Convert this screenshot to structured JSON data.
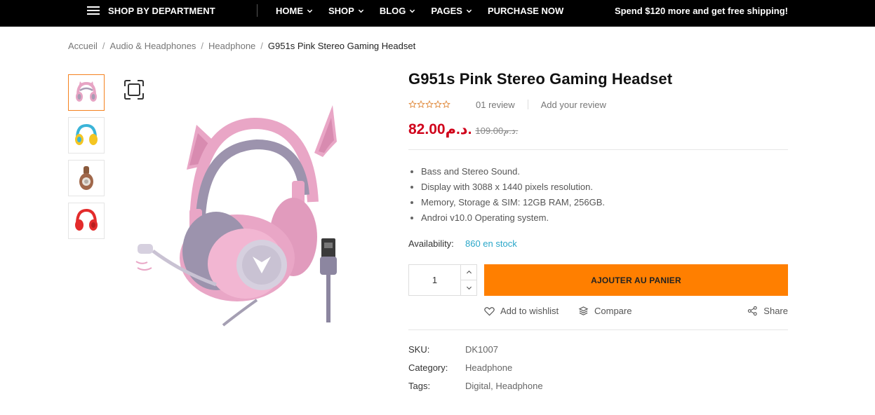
{
  "topbar": {
    "department_label": "SHOP BY DEPARTMENT",
    "menu": [
      {
        "label": "HOME"
      },
      {
        "label": "SHOP"
      },
      {
        "label": "BLOG"
      },
      {
        "label": "PAGES"
      },
      {
        "label": "PURCHASE NOW"
      }
    ],
    "promo": "Spend $120 more and get free shipping!"
  },
  "breadcrumb": {
    "items": [
      "Accueil",
      "Audio & Headphones",
      "Headphone"
    ],
    "separator": "/",
    "current": "G951s Pink Stereo Gaming Headset"
  },
  "gallery": {
    "thumbnails": [
      "pink-cat-ear-headset",
      "yellow-headphones",
      "wood-speaker",
      "red-headphones"
    ],
    "active_index": 0
  },
  "product": {
    "title": "G951s Pink Stereo Gaming Headset",
    "rating": 0,
    "review_count": "01 review",
    "add_review": "Add your review",
    "price": "82.00د.م.",
    "old_price": "109.00د.م.",
    "features": [
      "Bass and Stereo Sound.",
      "Display with 3088 x 1440 pixels resolution.",
      "Memory, Storage & SIM: 12GB RAM, 256GB.",
      "Androi v10.0 Operating system."
    ],
    "availability_label": "Availability:",
    "availability_value": "860 en stock",
    "quantity": "1",
    "add_to_cart": "AJOUTER AU PANIER",
    "wishlist": "Add to wishlist",
    "compare": "Compare",
    "share": "Share",
    "sku_label": "SKU:",
    "sku_value": "DK1007",
    "category_label": "Category:",
    "category_value": "Headphone",
    "tags_label": "Tags:",
    "tags": [
      "Digital",
      "Headphone"
    ]
  },
  "colors": {
    "accent": "#ff7f00",
    "price": "#d0021b",
    "stock": "#2aa7c9",
    "topbar": "#000000"
  }
}
